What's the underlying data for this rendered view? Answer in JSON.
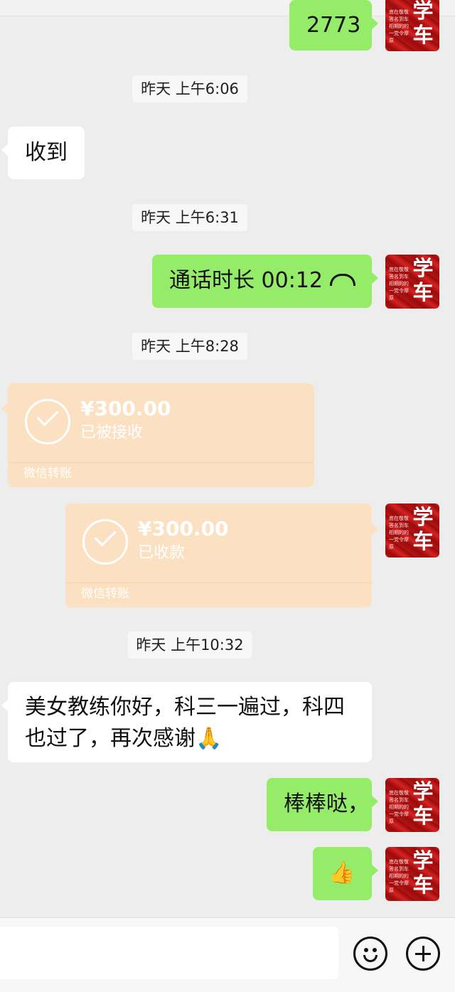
{
  "avatar_text": {
    "big": "学车",
    "small": "底在敬敬答名到车相期的的一党令摩原"
  },
  "messages": {
    "m0": {
      "text": "2773"
    },
    "ts1": {
      "text": "昨天 上午6:06"
    },
    "m1": {
      "text": "收到"
    },
    "ts2": {
      "text": "昨天 上午6:31"
    },
    "m2": {
      "text": "通话时长 00:12",
      "icon": "hang-up-icon"
    },
    "ts3": {
      "text": "昨天 上午8:28"
    },
    "t1": {
      "amount": "¥300.00",
      "status": "已被接收",
      "brand": "微信转账"
    },
    "t2": {
      "amount": "¥300.00",
      "status": "已收款",
      "brand": "微信转账"
    },
    "ts4": {
      "text": "昨天 上午10:32"
    },
    "m3": {
      "line1": "美女教练你好，科三一遍过，科四",
      "line2": "也过了，再次感谢🙏"
    },
    "m4": {
      "text": "棒棒哒，"
    },
    "m5": {
      "text": "👍"
    }
  },
  "input": {
    "placeholder": ""
  },
  "icons": [
    "emoji-icon",
    "plus-icon"
  ],
  "colors": {
    "sent_bubble": "#95ec69",
    "received_bubble": "#ffffff",
    "transfer_bubble": "#fbe0c2",
    "background": "#ededed"
  }
}
